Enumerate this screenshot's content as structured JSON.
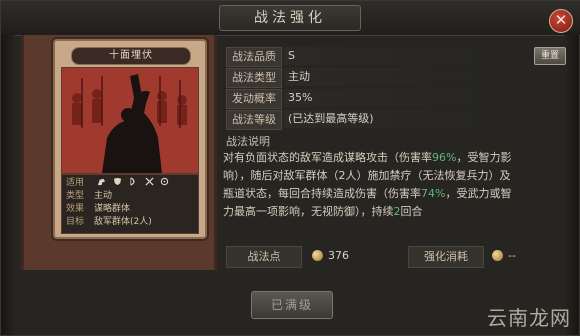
{
  "window": {
    "title": "战法强化",
    "close_glyph": "✕"
  },
  "card": {
    "name": "十面埋伏",
    "info": [
      {
        "key": "适用",
        "value": ""
      },
      {
        "key": "类型",
        "value": "主动"
      },
      {
        "key": "效果",
        "value": "谋略群体"
      },
      {
        "key": "目标",
        "value": "敌军群体(2人)"
      }
    ],
    "applicable_icons": [
      "cavalry-icon",
      "shield-icon",
      "bow-icon",
      "spear-icon",
      "wheel-icon"
    ]
  },
  "fields": {
    "quality": {
      "label": "战法品质",
      "value": "S"
    },
    "type": {
      "label": "战法类型",
      "value": "主动"
    },
    "rate": {
      "label": "发动概率",
      "value": "35%"
    },
    "level": {
      "label": "战法等级",
      "value": "(已达到最高等级)"
    }
  },
  "reset_label": "重置",
  "description": {
    "label": "战法说明",
    "line1_a": "对有负面状态的敌军造成谋略攻击（伤害率",
    "line1_hl": "96%",
    "line1_b": "，受智力影",
    "line2": "响），随后对敌军群体（2人）施加禁疗（无法恢复兵力）及",
    "line3_a": "瓶道状态，每回合持续造成伤害（伤害率",
    "line3_hl": "74%",
    "line3_b": "，受武力或智",
    "line4_a": "力最高一项影响，无视防御），持续",
    "line4_hl": "2",
    "line4_b": "回合"
  },
  "bottom": {
    "points_label": "战法点",
    "points_value": "376",
    "cost_label": "强化消耗",
    "cost_value": "--"
  },
  "upgrade_button": "已满级",
  "watermark": "云南龙网",
  "colors": {
    "highlight": "#5cb77c",
    "close": "#b3342a"
  }
}
